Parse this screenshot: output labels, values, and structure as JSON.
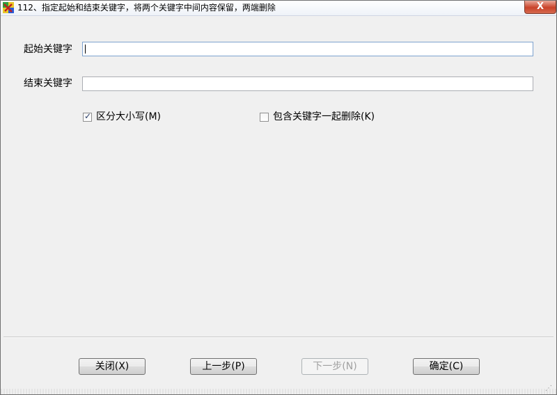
{
  "window": {
    "title": "112、指定起始和结束关键字，将两个关键字中间内容保留，两端删除",
    "close_glyph": "X"
  },
  "form": {
    "start_keyword_label": "起始关键字",
    "start_keyword_value": "",
    "end_keyword_label": "结束关键字",
    "end_keyword_value": "",
    "case_sensitive_label": "区分大小写(M)",
    "case_sensitive_checked": true,
    "include_keywords_label": "包含关键字一起删除(K)",
    "include_keywords_checked": false
  },
  "buttons": {
    "close_label": "关闭(X)",
    "prev_label": "上一步(P)",
    "next_label": "下一步(N)",
    "next_enabled": false,
    "ok_label": "确定(C)"
  },
  "colors": {
    "titlebar_close": "#c9432a",
    "checkbox_tick": "#2b3f6b",
    "focused_input_border": "#7da2ce"
  }
}
